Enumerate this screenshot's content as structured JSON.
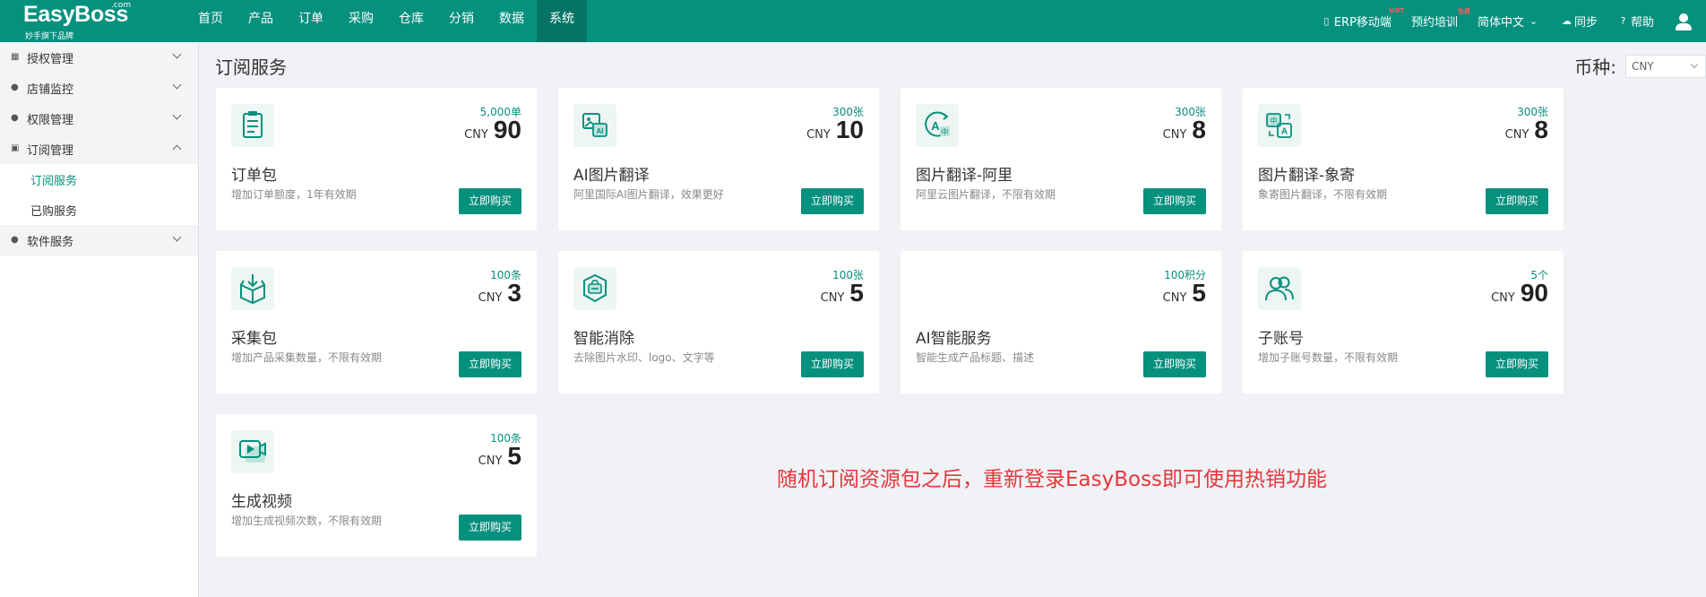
{
  "brand": {
    "name": "EasyBoss",
    "superscript": ".com",
    "slogan": "妙手旗下品牌"
  },
  "nav": [
    "首页",
    "产品",
    "订单",
    "采购",
    "仓库",
    "分销",
    "数据",
    "系统"
  ],
  "nav_active": "系统",
  "tools": {
    "erp_mobile": "ERP移动端",
    "hot_badge": "HOT",
    "training": "预约培训",
    "free_badge": "免费",
    "language": "简体中文",
    "sync": "同步",
    "help": "帮助"
  },
  "sidebar": [
    {
      "label": "授权管理",
      "icon": "grid-icon",
      "expanded": false
    },
    {
      "label": "店铺监控",
      "icon": "user-icon",
      "expanded": false
    },
    {
      "label": "权限管理",
      "icon": "user-icon",
      "expanded": false
    },
    {
      "label": "订阅管理",
      "icon": "bookmark-icon",
      "expanded": true,
      "children": [
        "订阅服务",
        "已购服务"
      ]
    },
    {
      "label": "软件服务",
      "icon": "user-icon",
      "expanded": false
    }
  ],
  "sidebar_active_child": "订阅服务",
  "page": {
    "title": "订阅服务",
    "currency_label": "币种:",
    "currency_value": "CNY"
  },
  "cards": [
    {
      "name": "订单包",
      "desc": "增加订单额度，1年有效期",
      "qty": "5,000单",
      "currency": "CNY",
      "price": "90",
      "button": "立即购买",
      "icon": "clipboard-icon"
    },
    {
      "name": "AI图片翻译",
      "desc": "阿里国际AI图片翻译，效果更好",
      "qty": "300张",
      "currency": "CNY",
      "price": "10",
      "button": "立即购买",
      "icon": "ai-image-icon"
    },
    {
      "name": "图片翻译-阿里",
      "desc": "阿里云图片翻译，不限有效期",
      "qty": "300张",
      "currency": "CNY",
      "price": "8",
      "button": "立即购买",
      "icon": "translate-icon"
    },
    {
      "name": "图片翻译-象寄",
      "desc": "象寄图片翻译，不限有效期",
      "qty": "300张",
      "currency": "CNY",
      "price": "8",
      "button": "立即购买",
      "icon": "translate-card-icon"
    },
    {
      "name": "采集包",
      "desc": "增加产品采集数量，不限有效期",
      "qty": "100条",
      "currency": "CNY",
      "price": "3",
      "button": "立即购买",
      "icon": "box-icon"
    },
    {
      "name": "智能消除",
      "desc": "去除图片水印、logo、文字等",
      "qty": "100张",
      "currency": "CNY",
      "price": "5",
      "button": "立即购买",
      "icon": "eraser-icon"
    },
    {
      "name": "AI智能服务",
      "desc": "智能生成产品标题、描述",
      "qty": "100积分",
      "currency": "CNY",
      "price": "5",
      "button": "立即购买",
      "icon": "ai-service-icon"
    },
    {
      "name": "子账号",
      "desc": "增加子账号数量，不限有效期",
      "qty": "5个",
      "currency": "CNY",
      "price": "90",
      "button": "立即购买",
      "icon": "users-icon"
    },
    {
      "name": "生成视频",
      "desc": "增加生成视频次数，不限有效期",
      "qty": "100条",
      "currency": "CNY",
      "price": "5",
      "button": "立即购买",
      "icon": "video-icon"
    }
  ],
  "note": "随机订阅资源包之后，重新登录EasyBoss即可使用热销功能",
  "colors": {
    "primary": "#06907e",
    "note": "#e8353a"
  }
}
